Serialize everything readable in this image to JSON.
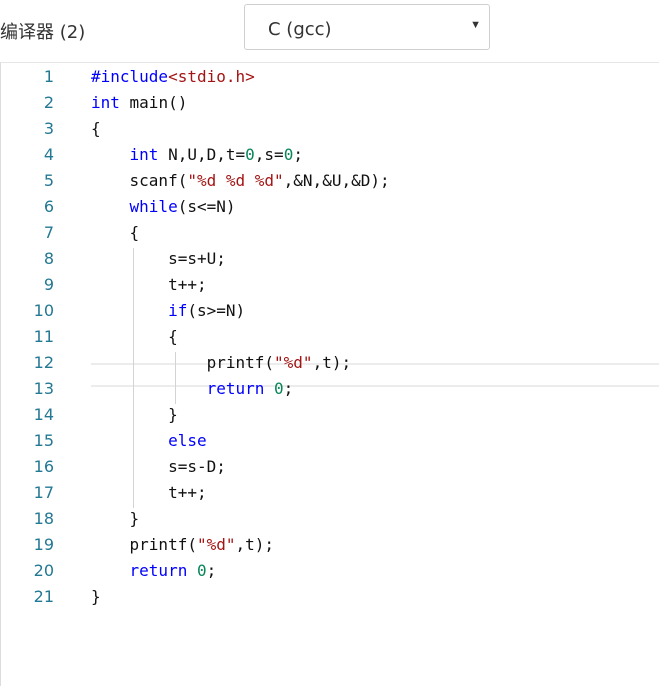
{
  "header": {
    "compiler_label": "编译器 (2)",
    "compiler_select": {
      "selected": "C (gcc)",
      "arrow": "▼"
    }
  },
  "editor": {
    "active_line": 10,
    "lines": [
      {
        "n": "1",
        "tokens": [
          {
            "t": "#include",
            "c": "kw"
          },
          {
            "t": "<stdio.h>",
            "c": "str"
          }
        ]
      },
      {
        "n": "2",
        "tokens": [
          {
            "t": "int",
            "c": "kw"
          },
          {
            "t": " main()"
          }
        ]
      },
      {
        "n": "3",
        "tokens": [
          {
            "t": "{"
          }
        ]
      },
      {
        "n": "4",
        "tokens": [
          {
            "t": "    "
          },
          {
            "t": "int",
            "c": "kw"
          },
          {
            "t": " N,U,D,t="
          },
          {
            "t": "0",
            "c": "num"
          },
          {
            "t": ",s="
          },
          {
            "t": "0",
            "c": "num"
          },
          {
            "t": ";"
          }
        ]
      },
      {
        "n": "5",
        "tokens": [
          {
            "t": "    scanf("
          },
          {
            "t": "\"%d %d %d\"",
            "c": "str"
          },
          {
            "t": ",&N,&U,&D);"
          }
        ]
      },
      {
        "n": "6",
        "tokens": [
          {
            "t": "    "
          },
          {
            "t": "while",
            "c": "kw"
          },
          {
            "t": "(s<=N)"
          }
        ]
      },
      {
        "n": "7",
        "tokens": [
          {
            "t": "    {"
          }
        ]
      },
      {
        "n": "8",
        "tokens": [
          {
            "t": "        s=s+U;"
          }
        ]
      },
      {
        "n": "9",
        "tokens": [
          {
            "t": "        t++;"
          }
        ]
      },
      {
        "n": "10",
        "tokens": [
          {
            "t": "        "
          },
          {
            "t": "if",
            "c": "kw"
          },
          {
            "t": "(s>=N)"
          }
        ]
      },
      {
        "n": "11",
        "tokens": [
          {
            "t": "        {"
          }
        ]
      },
      {
        "n": "12",
        "tokens": [
          {
            "t": "            printf("
          },
          {
            "t": "\"%d\"",
            "c": "str"
          },
          {
            "t": ",t);"
          }
        ]
      },
      {
        "n": "13",
        "tokens": [
          {
            "t": "            "
          },
          {
            "t": "return",
            "c": "kw"
          },
          {
            "t": " "
          },
          {
            "t": "0",
            "c": "num"
          },
          {
            "t": ";"
          }
        ]
      },
      {
        "n": "14",
        "tokens": [
          {
            "t": "        }"
          }
        ]
      },
      {
        "n": "15",
        "tokens": [
          {
            "t": "        "
          },
          {
            "t": "else",
            "c": "kw"
          }
        ]
      },
      {
        "n": "16",
        "tokens": [
          {
            "t": "        s=s-D;"
          }
        ]
      },
      {
        "n": "17",
        "tokens": [
          {
            "t": "        t++;"
          }
        ]
      },
      {
        "n": "18",
        "tokens": [
          {
            "t": "    }"
          }
        ]
      },
      {
        "n": "19",
        "tokens": [
          {
            "t": "    printf("
          },
          {
            "t": "\"%d\"",
            "c": "str"
          },
          {
            "t": ",t);"
          }
        ]
      },
      {
        "n": "20",
        "tokens": [
          {
            "t": "    "
          },
          {
            "t": "return",
            "c": "kw"
          },
          {
            "t": " "
          },
          {
            "t": "0",
            "c": "num"
          },
          {
            "t": ";"
          }
        ]
      },
      {
        "n": "21",
        "tokens": [
          {
            "t": "}"
          }
        ]
      }
    ]
  },
  "colors": {
    "keyword": "#0000ff",
    "string": "#a31515",
    "number": "#098658",
    "line_number": "#237893"
  }
}
